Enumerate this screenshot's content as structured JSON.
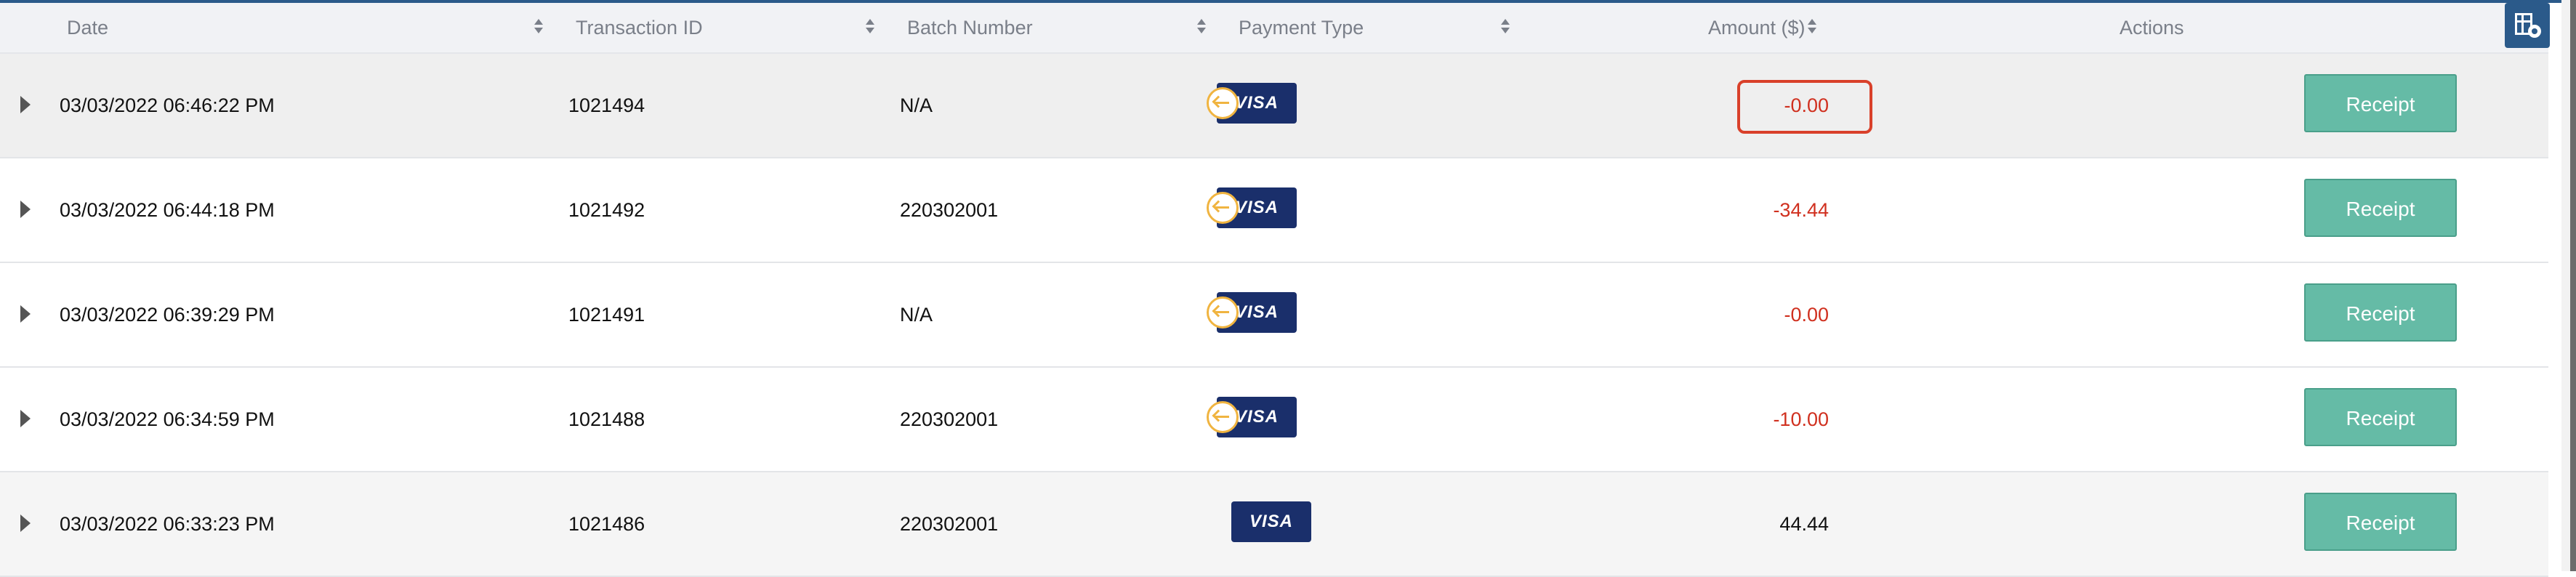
{
  "table": {
    "headers": {
      "date": "Date",
      "transaction_id": "Transaction ID",
      "batch_number": "Batch Number",
      "payment_type": "Payment Type",
      "amount": "Amount ($)",
      "actions": "Actions"
    },
    "rows": [
      {
        "date": "03/03/2022 06:46:22 PM",
        "transaction_id": "1021494",
        "batch_number": "N/A",
        "card_brand": "VISA",
        "amount": "-0.00",
        "receipt_label": "Receipt"
      },
      {
        "date": "03/03/2022 06:44:18 PM",
        "transaction_id": "1021492",
        "batch_number": "220302001",
        "card_brand": "VISA",
        "amount": "-34.44",
        "receipt_label": "Receipt"
      },
      {
        "date": "03/03/2022 06:39:29 PM",
        "transaction_id": "1021491",
        "batch_number": "N/A",
        "card_brand": "VISA",
        "amount": "-0.00",
        "receipt_label": "Receipt"
      },
      {
        "date": "03/03/2022 06:34:59 PM",
        "transaction_id": "1021488",
        "batch_number": "220302001",
        "card_brand": "VISA",
        "amount": "-10.00",
        "receipt_label": "Receipt"
      },
      {
        "date": "03/03/2022 06:33:23 PM",
        "transaction_id": "1021486",
        "batch_number": "220302001",
        "card_brand": "VISA",
        "amount": "44.44",
        "receipt_label": "Receipt"
      }
    ]
  },
  "icons": {
    "sort": "sort-icon",
    "expand": "expand-caret-icon",
    "refund": "refund-arrow-icon",
    "column_settings": "column-settings-icon"
  },
  "colors": {
    "negative_amount": "#d0301f",
    "receipt_button": "#65bba6",
    "highlight_border": "#d9402a",
    "header_accent": "#2b5a8a"
  }
}
